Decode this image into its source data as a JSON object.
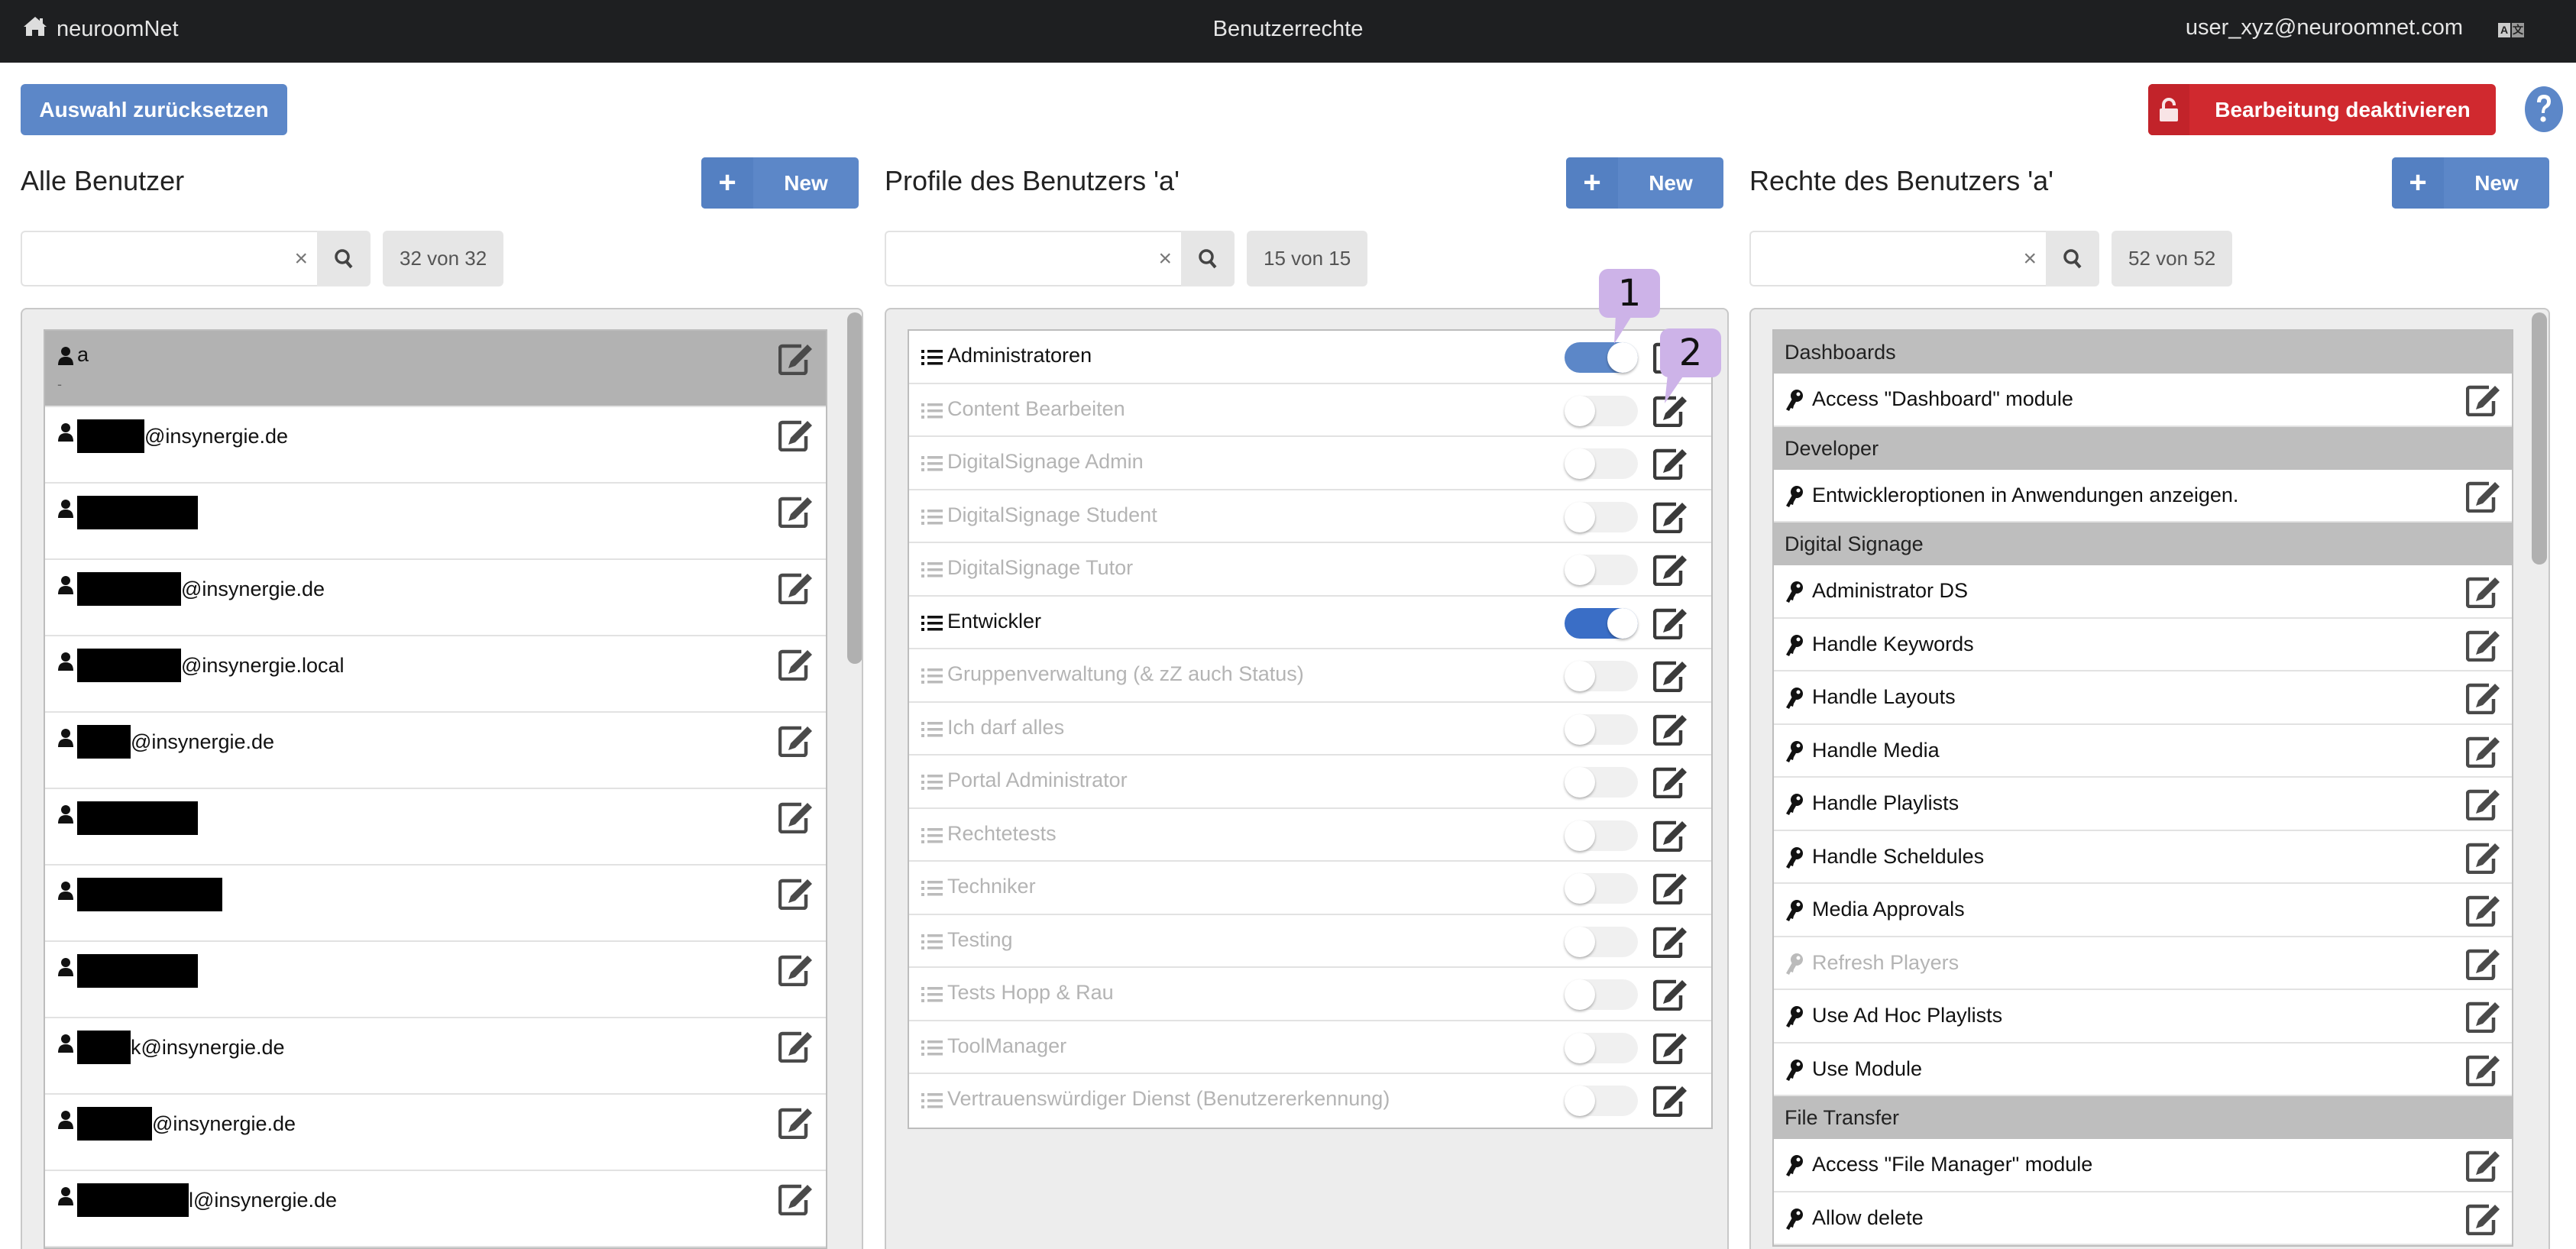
{
  "topbar": {
    "brand": "neuroomNet",
    "title": "Benutzerrechte",
    "user": "user_xyz@neuroomnet.com",
    "language_icon": "translate-icon"
  },
  "actions": {
    "reset_label": "Auswahl zurücksetzen",
    "disable_label": "Bearbeitung deaktivieren",
    "help_icon": "question-circle-icon"
  },
  "colors": {
    "primary": "#5c87c8",
    "danger": "#d0292f",
    "topbar": "#1e1f21",
    "selected_row": "#b2b2b2",
    "group_header": "#bebebe",
    "callout": "#cdb3e8"
  },
  "users": {
    "title": "Alle Benutzer",
    "new_label": "New",
    "search_value": "",
    "count": "32 von 32",
    "items": [
      {
        "name_visible": "a",
        "subtitle": "-",
        "redacted": false,
        "selected": true
      },
      {
        "name_visible": "@insynergie.de",
        "subtitle": "",
        "redacted": true,
        "selected": false
      },
      {
        "name_visible": "",
        "subtitle": "",
        "redacted": true,
        "selected": false
      },
      {
        "name_visible": "@insynergie.de",
        "subtitle": "",
        "redacted": true,
        "selected": false
      },
      {
        "name_visible": "@insynergie.local",
        "subtitle": "",
        "redacted": true,
        "selected": false
      },
      {
        "name_visible": "@insynergie.de",
        "subtitle": "",
        "redacted": true,
        "selected": false
      },
      {
        "name_visible": "",
        "subtitle": "",
        "redacted": true,
        "selected": false
      },
      {
        "name_visible": "",
        "subtitle": "",
        "redacted": true,
        "selected": false
      },
      {
        "name_visible": "",
        "subtitle": "",
        "redacted": true,
        "selected": false
      },
      {
        "name_visible": "k@insynergie.de",
        "subtitle": "",
        "redacted": true,
        "selected": false
      },
      {
        "name_visible": "@insynergie.de",
        "subtitle": "",
        "redacted": true,
        "selected": false
      },
      {
        "name_visible": "l@insynergie.de",
        "subtitle": "",
        "redacted": true,
        "selected": false
      }
    ]
  },
  "profiles": {
    "title": "Profile des Benutzers 'a'",
    "new_label": "New",
    "search_value": "",
    "count": "15 von 15",
    "items": [
      {
        "name": "Administratoren",
        "enabled": true
      },
      {
        "name": "Content Bearbeiten",
        "enabled": false
      },
      {
        "name": "DigitalSignage Admin",
        "enabled": false
      },
      {
        "name": "DigitalSignage Student",
        "enabled": false
      },
      {
        "name": "DigitalSignage Tutor",
        "enabled": false
      },
      {
        "name": "Entwickler",
        "enabled": true
      },
      {
        "name": "Gruppenverwaltung (& zZ auch Status)",
        "enabled": false
      },
      {
        "name": "Ich darf alles",
        "enabled": false
      },
      {
        "name": "Portal Administrator",
        "enabled": false
      },
      {
        "name": "Rechtetests",
        "enabled": false
      },
      {
        "name": "Techniker",
        "enabled": false
      },
      {
        "name": "Testing",
        "enabled": false
      },
      {
        "name": "Tests Hopp & Rau",
        "enabled": false
      },
      {
        "name": "ToolManager",
        "enabled": false
      },
      {
        "name": "Vertrauenswürdiger Dienst (Benutzererkennung)",
        "enabled": false
      }
    ]
  },
  "rights": {
    "title": "Rechte des Benutzers 'a'",
    "new_label": "New",
    "search_value": "",
    "count": "52 von 52",
    "groups": [
      {
        "name": "Dashboards",
        "items": [
          {
            "name": "Access \"Dashboard\" module",
            "granted": true
          }
        ]
      },
      {
        "name": "Developer",
        "items": [
          {
            "name": "Entwickleroptionen in Anwendungen anzeigen.",
            "granted": true
          }
        ]
      },
      {
        "name": "Digital Signage",
        "items": [
          {
            "name": "Administrator DS",
            "granted": true
          },
          {
            "name": "Handle Keywords",
            "granted": true
          },
          {
            "name": "Handle Layouts",
            "granted": true
          },
          {
            "name": "Handle Media",
            "granted": true
          },
          {
            "name": "Handle Playlists",
            "granted": true
          },
          {
            "name": "Handle Scheldules",
            "granted": true
          },
          {
            "name": "Media Approvals",
            "granted": true
          },
          {
            "name": "Refresh Players",
            "granted": false
          },
          {
            "name": "Use Ad Hoc Playlists",
            "granted": true
          },
          {
            "name": "Use Module",
            "granted": true
          }
        ]
      },
      {
        "name": "File Transfer",
        "items": [
          {
            "name": "Access \"File Manager\" module",
            "granted": true
          },
          {
            "name": "Allow delete",
            "granted": true
          }
        ]
      }
    ]
  },
  "callouts": [
    {
      "label": "1",
      "target": "Administratoren toggle"
    },
    {
      "label": "2",
      "target": "Content Bearbeiten edit button"
    }
  ]
}
